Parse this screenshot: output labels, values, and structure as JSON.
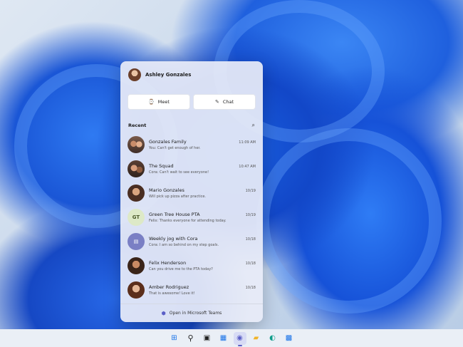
{
  "profile": {
    "name": "Ashley Gonzales"
  },
  "actions": [
    {
      "label": "Meet",
      "icon": "⌚"
    },
    {
      "label": "Chat",
      "icon": "✎"
    }
  ],
  "recent": {
    "title": "Recent",
    "search_icon": "⌕"
  },
  "conversations": [
    {
      "name": "Gonzales Family",
      "time": "11:09 AM",
      "preview": "You: Can't get enough of her.",
      "avatar": ""
    },
    {
      "name": "The Squad",
      "time": "10:47 AM",
      "preview": "Cora: Can't wait to see everyone!",
      "avatar": ""
    },
    {
      "name": "Mario Gonzales",
      "time": "10/19",
      "preview": "Will pick up pizza after practice.",
      "avatar": ""
    },
    {
      "name": "Green Tree House PTA",
      "time": "10/19",
      "preview": "Felix: Thanks everyone for attending today.",
      "avatar": "GT"
    },
    {
      "name": "Weekly jog with Cora",
      "time": "10/18",
      "preview": "Cora: I am so behind on my step goals.",
      "avatar": "▤"
    },
    {
      "name": "Felix Henderson",
      "time": "10/18",
      "preview": "Can you drive me to the PTA today?",
      "avatar": ""
    },
    {
      "name": "Amber Rodriguez",
      "time": "10/18",
      "preview": "That is awesome! Love it!",
      "avatar": ""
    }
  ],
  "footer": {
    "label": "Open in Microsoft Teams",
    "icon": "⬢"
  },
  "taskbar": {
    "start": "⊞",
    "search": "⚲",
    "taskview": "▣",
    "widgets": "▦",
    "chat": "◉",
    "explorer": "▰",
    "edge": "◐",
    "store": "▩"
  }
}
